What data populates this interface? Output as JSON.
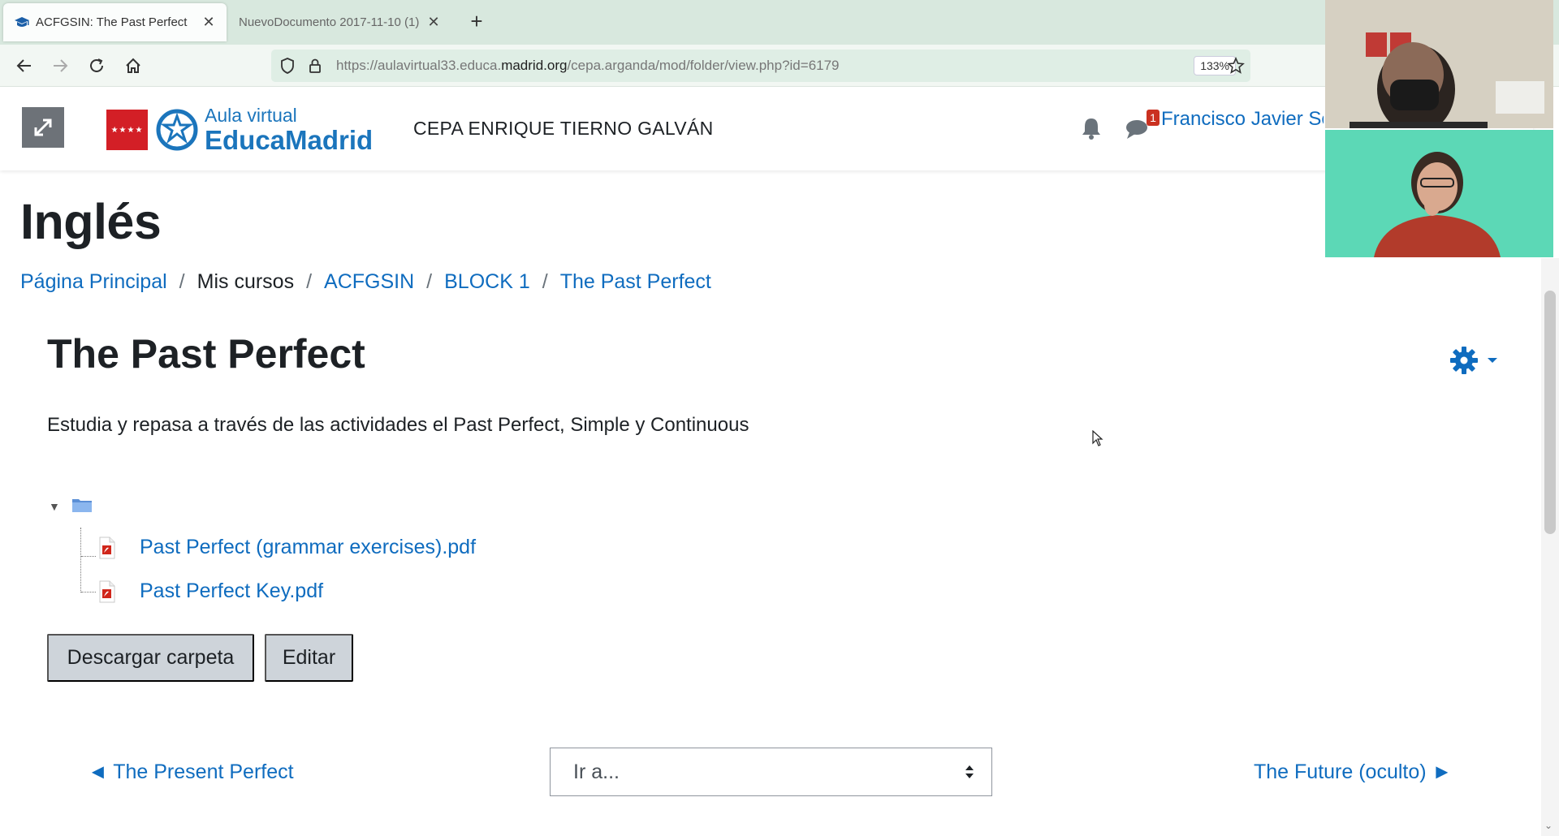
{
  "browser": {
    "tabs": [
      {
        "title": "ACFGSIN: The Past Perfect",
        "close": "✕"
      },
      {
        "title": "NuevoDocumento 2017-11-10 (1)",
        "close": "✕"
      }
    ],
    "new_tab": "+",
    "url_prefix": "https://aulavirtual33.educa.",
    "url_domain": "madrid.org",
    "url_path": "/cepa.arganda/mod/folder/view.php?id=6179",
    "zoom": "133%"
  },
  "header": {
    "logo_line1": "Aula virtual",
    "logo_line2": "EducaMadrid",
    "site_name": "CEPA ENRIQUE TIERNO GALVÁN",
    "chat_badge": "1",
    "user_name": "Francisco Javier Se"
  },
  "page": {
    "course_title": "Inglés",
    "breadcrumb": [
      {
        "label": "Página Principal",
        "link": true
      },
      {
        "label": "Mis cursos",
        "link": false
      },
      {
        "label": "ACFGSIN",
        "link": true
      },
      {
        "label": "BLOCK 1",
        "link": true
      },
      {
        "label": "The Past Perfect",
        "link": true
      }
    ],
    "breadcrumb_separator": "/",
    "activity_title": "The Past Perfect",
    "description": "Estudia y repasa a través de las actividades el Past Perfect, Simple y Continuous",
    "files": [
      {
        "name": "Past Perfect (grammar exercises).pdf"
      },
      {
        "name": "Past Perfect Key.pdf"
      }
    ],
    "download_button": "Descargar carpeta",
    "edit_button": "Editar",
    "prev_activity": "◄ The Present Perfect",
    "next_activity": "The Future (oculto) ►",
    "jump_to": "Ir a..."
  },
  "colors": {
    "link": "#0f6cbf",
    "button_bg": "#ced4da",
    "tab_strip": "#d8e8de",
    "madrid_red": "#d31f26"
  }
}
